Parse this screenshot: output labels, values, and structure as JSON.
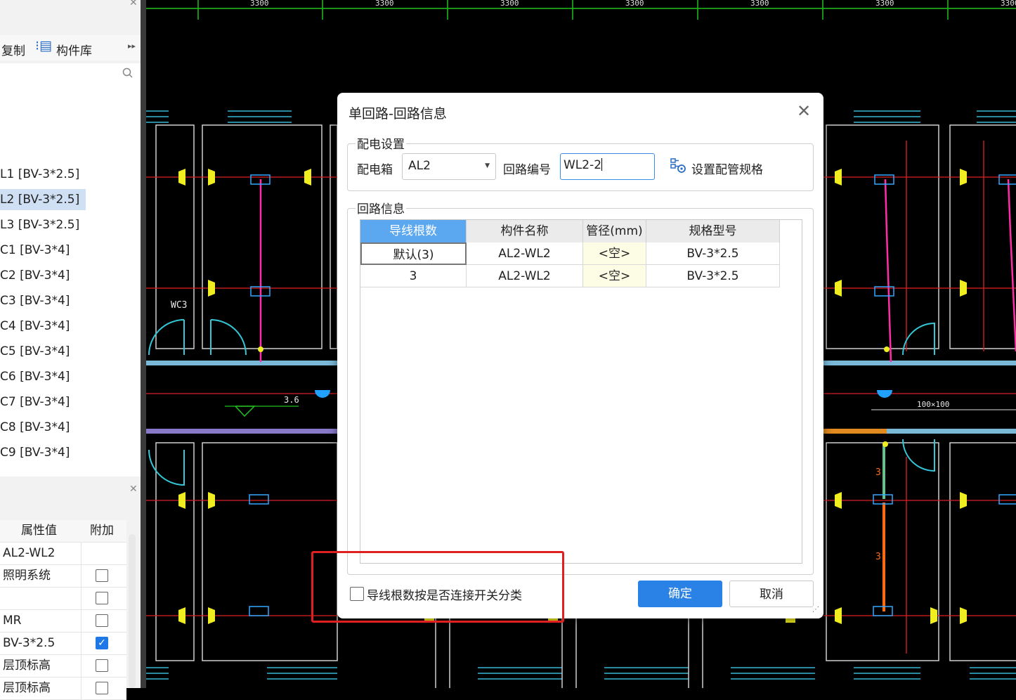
{
  "cad": {
    "dims": [
      "3300",
      "3300",
      "3300",
      "3300",
      "3300",
      "3300",
      "3300",
      "33"
    ],
    "labels": {
      "wc3": "WC3",
      "elev": "3.6",
      "pipe_size": "100×100",
      "n3a": "3",
      "n3b": "3"
    }
  },
  "left_panel": {
    "toolbar": {
      "copy": "复制",
      "library": "构件库"
    },
    "list_items": [
      "L1 [BV-3*2.5]",
      "L2 [BV-3*2.5]",
      "L3 [BV-3*2.5]",
      "C1 [BV-3*4]",
      "C2 [BV-3*4]",
      "C3 [BV-3*4]",
      "C4 [BV-3*4]",
      "C5 [BV-3*4]",
      "C6 [BV-3*4]",
      "C7 [BV-3*4]",
      "C8 [BV-3*4]",
      "C9 [BV-3*4]"
    ],
    "selected_index": 1,
    "props": {
      "headers": {
        "value": "属性值",
        "extra": "附加"
      },
      "rows": [
        {
          "value": "AL2-WL2",
          "checkbox": null
        },
        {
          "value": "照明系统",
          "checkbox": false
        },
        {
          "value": "",
          "checkbox": false
        },
        {
          "value": "MR",
          "checkbox": false
        },
        {
          "value": "BV-3*2.5",
          "checkbox": true
        },
        {
          "value": "层顶标高",
          "checkbox": false
        },
        {
          "value": "层顶标高",
          "checkbox": false
        }
      ]
    }
  },
  "dialog": {
    "title": "单回路-回路信息",
    "power_group": "配电设置",
    "panel_label": "配电箱",
    "panel_value": "AL2",
    "circuit_label": "回路编号",
    "circuit_value": "WL2-2",
    "set_pipe": "设置配管规格",
    "info_group": "回路信息",
    "table": {
      "headers": [
        "导线根数",
        "构件名称",
        "管径(mm)",
        "规格型号"
      ],
      "rows": [
        [
          "默认(3)",
          "AL2-WL2",
          "<空>",
          "BV-3*2.5"
        ],
        [
          "3",
          "AL2-WL2",
          "<空>",
          "BV-3*2.5"
        ]
      ]
    },
    "checkbox_label": "导线根数按是否连接开关分类",
    "ok": "确定",
    "cancel": "取消"
  }
}
